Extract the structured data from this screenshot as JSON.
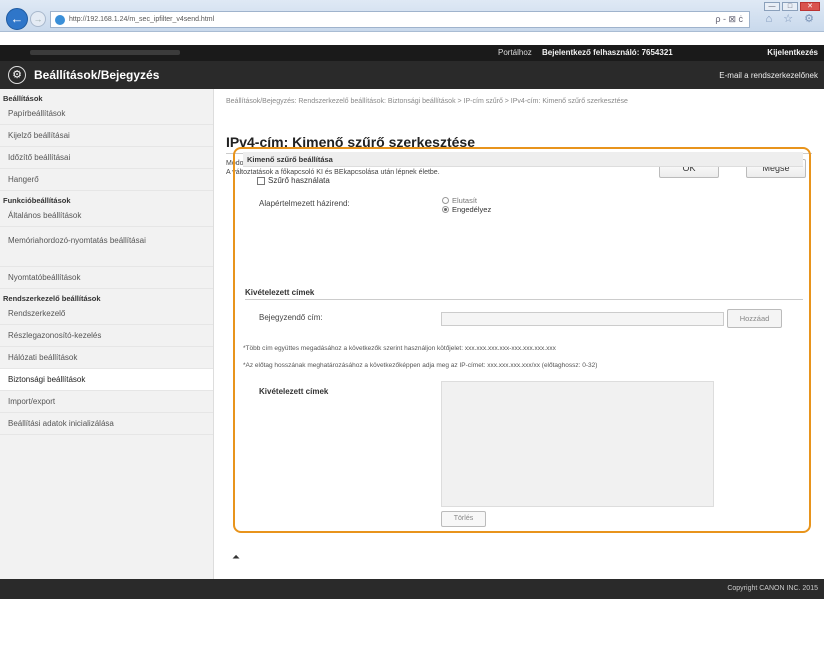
{
  "browser": {
    "url": "http://192.168.1.24/m_sec_ipfilter_v4send.html",
    "addr_tools": "ρ - ⊠ ċ",
    "icons": "⌂ ☆ ⚙",
    "window_controls": [
      "—",
      "□",
      "✕"
    ]
  },
  "header": {
    "portal_link": "Portálhoz",
    "user": "Bejelentkező felhasználó: 7654321",
    "logout": "Kijelentkezés",
    "app_title": "Beállítások/Bejegyzés",
    "email_admin": "E-mail a rendszerkezelőnek"
  },
  "sidebar": {
    "groups": [
      {
        "head": "Beállítások",
        "items": [
          "Papírbeállítások",
          "Kijelző beállításai",
          "Időzítő beállításai",
          "Hangerő"
        ]
      },
      {
        "head": "Funkcióbeállítások",
        "items": [
          "Általános beállítások",
          "Memóriahordozó-nyomtatás beállításai",
          "Nyomtatóbeállítások"
        ]
      },
      {
        "head": "Rendszerkezelő beállítások",
        "items": [
          "Rendszerkezelő",
          "Részlegazonosító-kezelés",
          "Hálózati beállítások",
          "Biztonsági beállítások",
          "Import/export",
          "Beállítási adatok inicializálása"
        ]
      }
    ],
    "active": "Biztonsági beállítások"
  },
  "main": {
    "breadcrumb": "Beállítások/Bejegyzés: Rendszerkezelő beállítások: Biztonsági beállítások > IP-cím szűrő > IPv4-cím: Kimenő szűrő szerkesztése",
    "title": "IPv4-cím: Kimenő szűrő szerkesztése",
    "instruction_1": "Módosítsa a következő beállításokat.",
    "instruction_2": "A változtatások a főkapcsoló KI és BEkapcsolása után lépnek életbe.",
    "ok": "OK",
    "cancel": "Mégse",
    "section_title": "Kimenő szűrő beállítása",
    "use_filter": "Szűrő használata",
    "default_policy_label": "Alapértelmezett házirend:",
    "policy_reject": "Elutasít",
    "policy_allow": "Engedélyez",
    "exceptions_head": "Kivételezett címek",
    "register_label": "Bejegyzendő cím:",
    "add_button": "Hozzáad",
    "note_1": "*Több cím együttes megadásához a következők szerint használjon kötőjelet: xxx.xxx.xxx.xxx-xxx.xxx.xxx.xxx",
    "note_2": "*Az előtag hosszának meghatározásához a következőképpen adja meg az IP-címet: xxx.xxx.xxx.xxx/xx (előtaghossz: 0-32)",
    "exceptions_list_label": "Kivételezett címek",
    "delete_button": "Törlés",
    "to_top": "⏶"
  },
  "footer": {
    "copyright": "Copyright CANON INC. 2015"
  }
}
